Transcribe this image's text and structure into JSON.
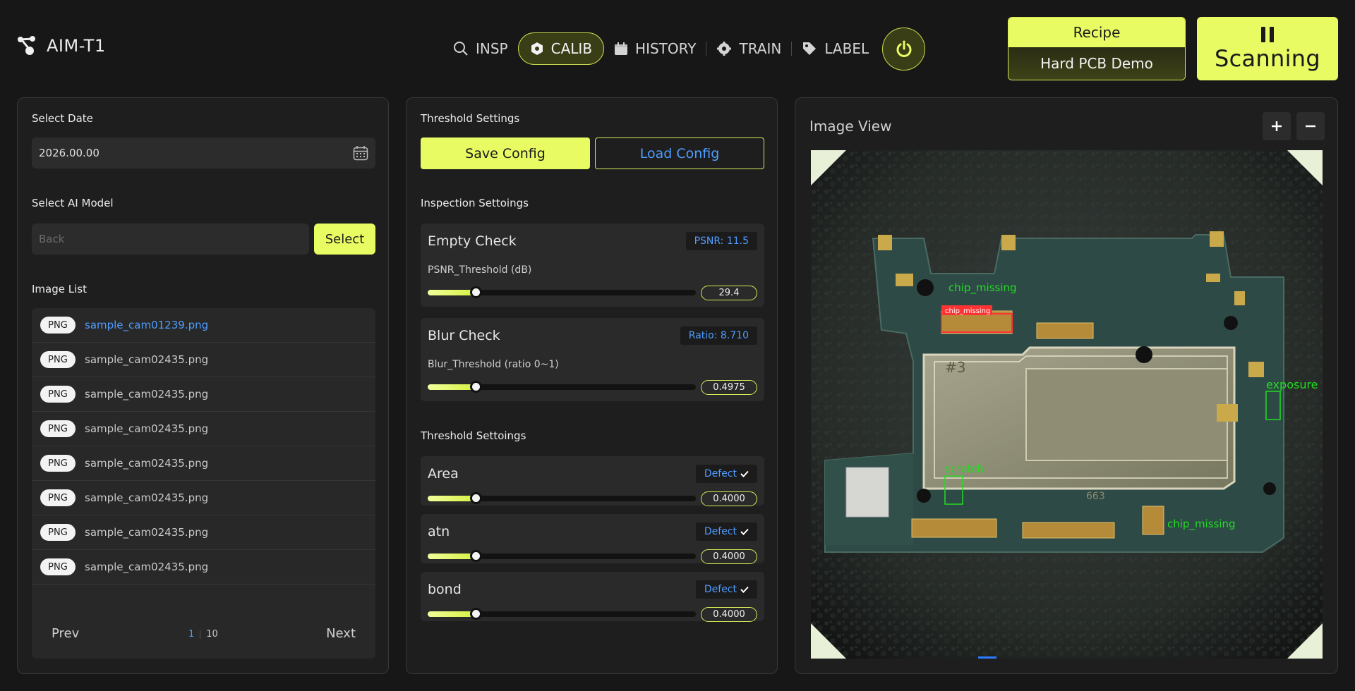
{
  "app": {
    "name": "AIM-T1"
  },
  "nav": {
    "items": [
      {
        "id": "insp",
        "label": "INSP",
        "icon": "search-icon"
      },
      {
        "id": "calib",
        "label": "CALIB",
        "icon": "hexagon-icon",
        "active": true
      },
      {
        "id": "history",
        "label": "HISTORY",
        "icon": "calendar-icon"
      },
      {
        "id": "train",
        "label": "TRAIN",
        "icon": "gear-icon"
      },
      {
        "id": "label",
        "label": "LABEL",
        "icon": "tag-icon"
      }
    ],
    "power_icon": "power-icon"
  },
  "recipe": {
    "label": "Recipe",
    "value": "Hard PCB Demo"
  },
  "scan": {
    "label": "Scanning",
    "icon": "pause-icon"
  },
  "left": {
    "date_title": "Select Date",
    "date_value": "2026.00.00",
    "model_title": "Select AI Model",
    "model_placeholder": "Back",
    "select_label": "Select",
    "list_title": "Image List",
    "badge": "PNG",
    "images": [
      "sample_cam01239.png",
      "sample_cam02435.png",
      "sample_cam02435.png",
      "sample_cam02435.png",
      "sample_cam02435.png",
      "sample_cam02435.png",
      "sample_cam02435.png",
      "sample_cam02435.png"
    ],
    "selected_index": 0,
    "prev_label": "Prev",
    "next_label": "Next",
    "page_current": "1",
    "page_total": "10"
  },
  "middle": {
    "threshold_title": "Threshold Settings",
    "save_label": "Save Config",
    "load_label": "Load Config",
    "inspection_title": "Inspection Settoings",
    "empty": {
      "title": "Empty Check",
      "badge": "PSNR: 11.5",
      "sub": "PSNR_Threshold (dB)",
      "value": "29.4",
      "level": 0.18
    },
    "blur": {
      "title": "Blur Check",
      "badge": "Ratio: 8.710",
      "sub": "Blur_Threshold (ratio 0~1)",
      "value": "0.4975",
      "level": 0.18
    },
    "threshold2_title": "Threshold Settoings",
    "defects": [
      {
        "title": "Area",
        "badge": "Defect",
        "value": "0.4000",
        "level": 0.18
      },
      {
        "title": "atn",
        "badge": "Defect",
        "value": "0.4000",
        "level": 0.18
      },
      {
        "title": "bond",
        "badge": "Defect",
        "value": "0.4000",
        "level": 0.18
      }
    ]
  },
  "right": {
    "title": "Image View",
    "detections": [
      {
        "label": "chip_missing"
      },
      {
        "label": "chip_missing"
      },
      {
        "label": "exposure"
      },
      {
        "label": "scratch"
      },
      {
        "label": "chip_missing"
      }
    ],
    "pcb_marks": [
      "#3",
      "663"
    ]
  },
  "colors": {
    "accent": "#e8fb63",
    "link": "#4f9cff",
    "bg": "#171717",
    "panel": "#1e1e1e",
    "detect_green": "#22dd22",
    "detect_red": "#ff3333"
  }
}
